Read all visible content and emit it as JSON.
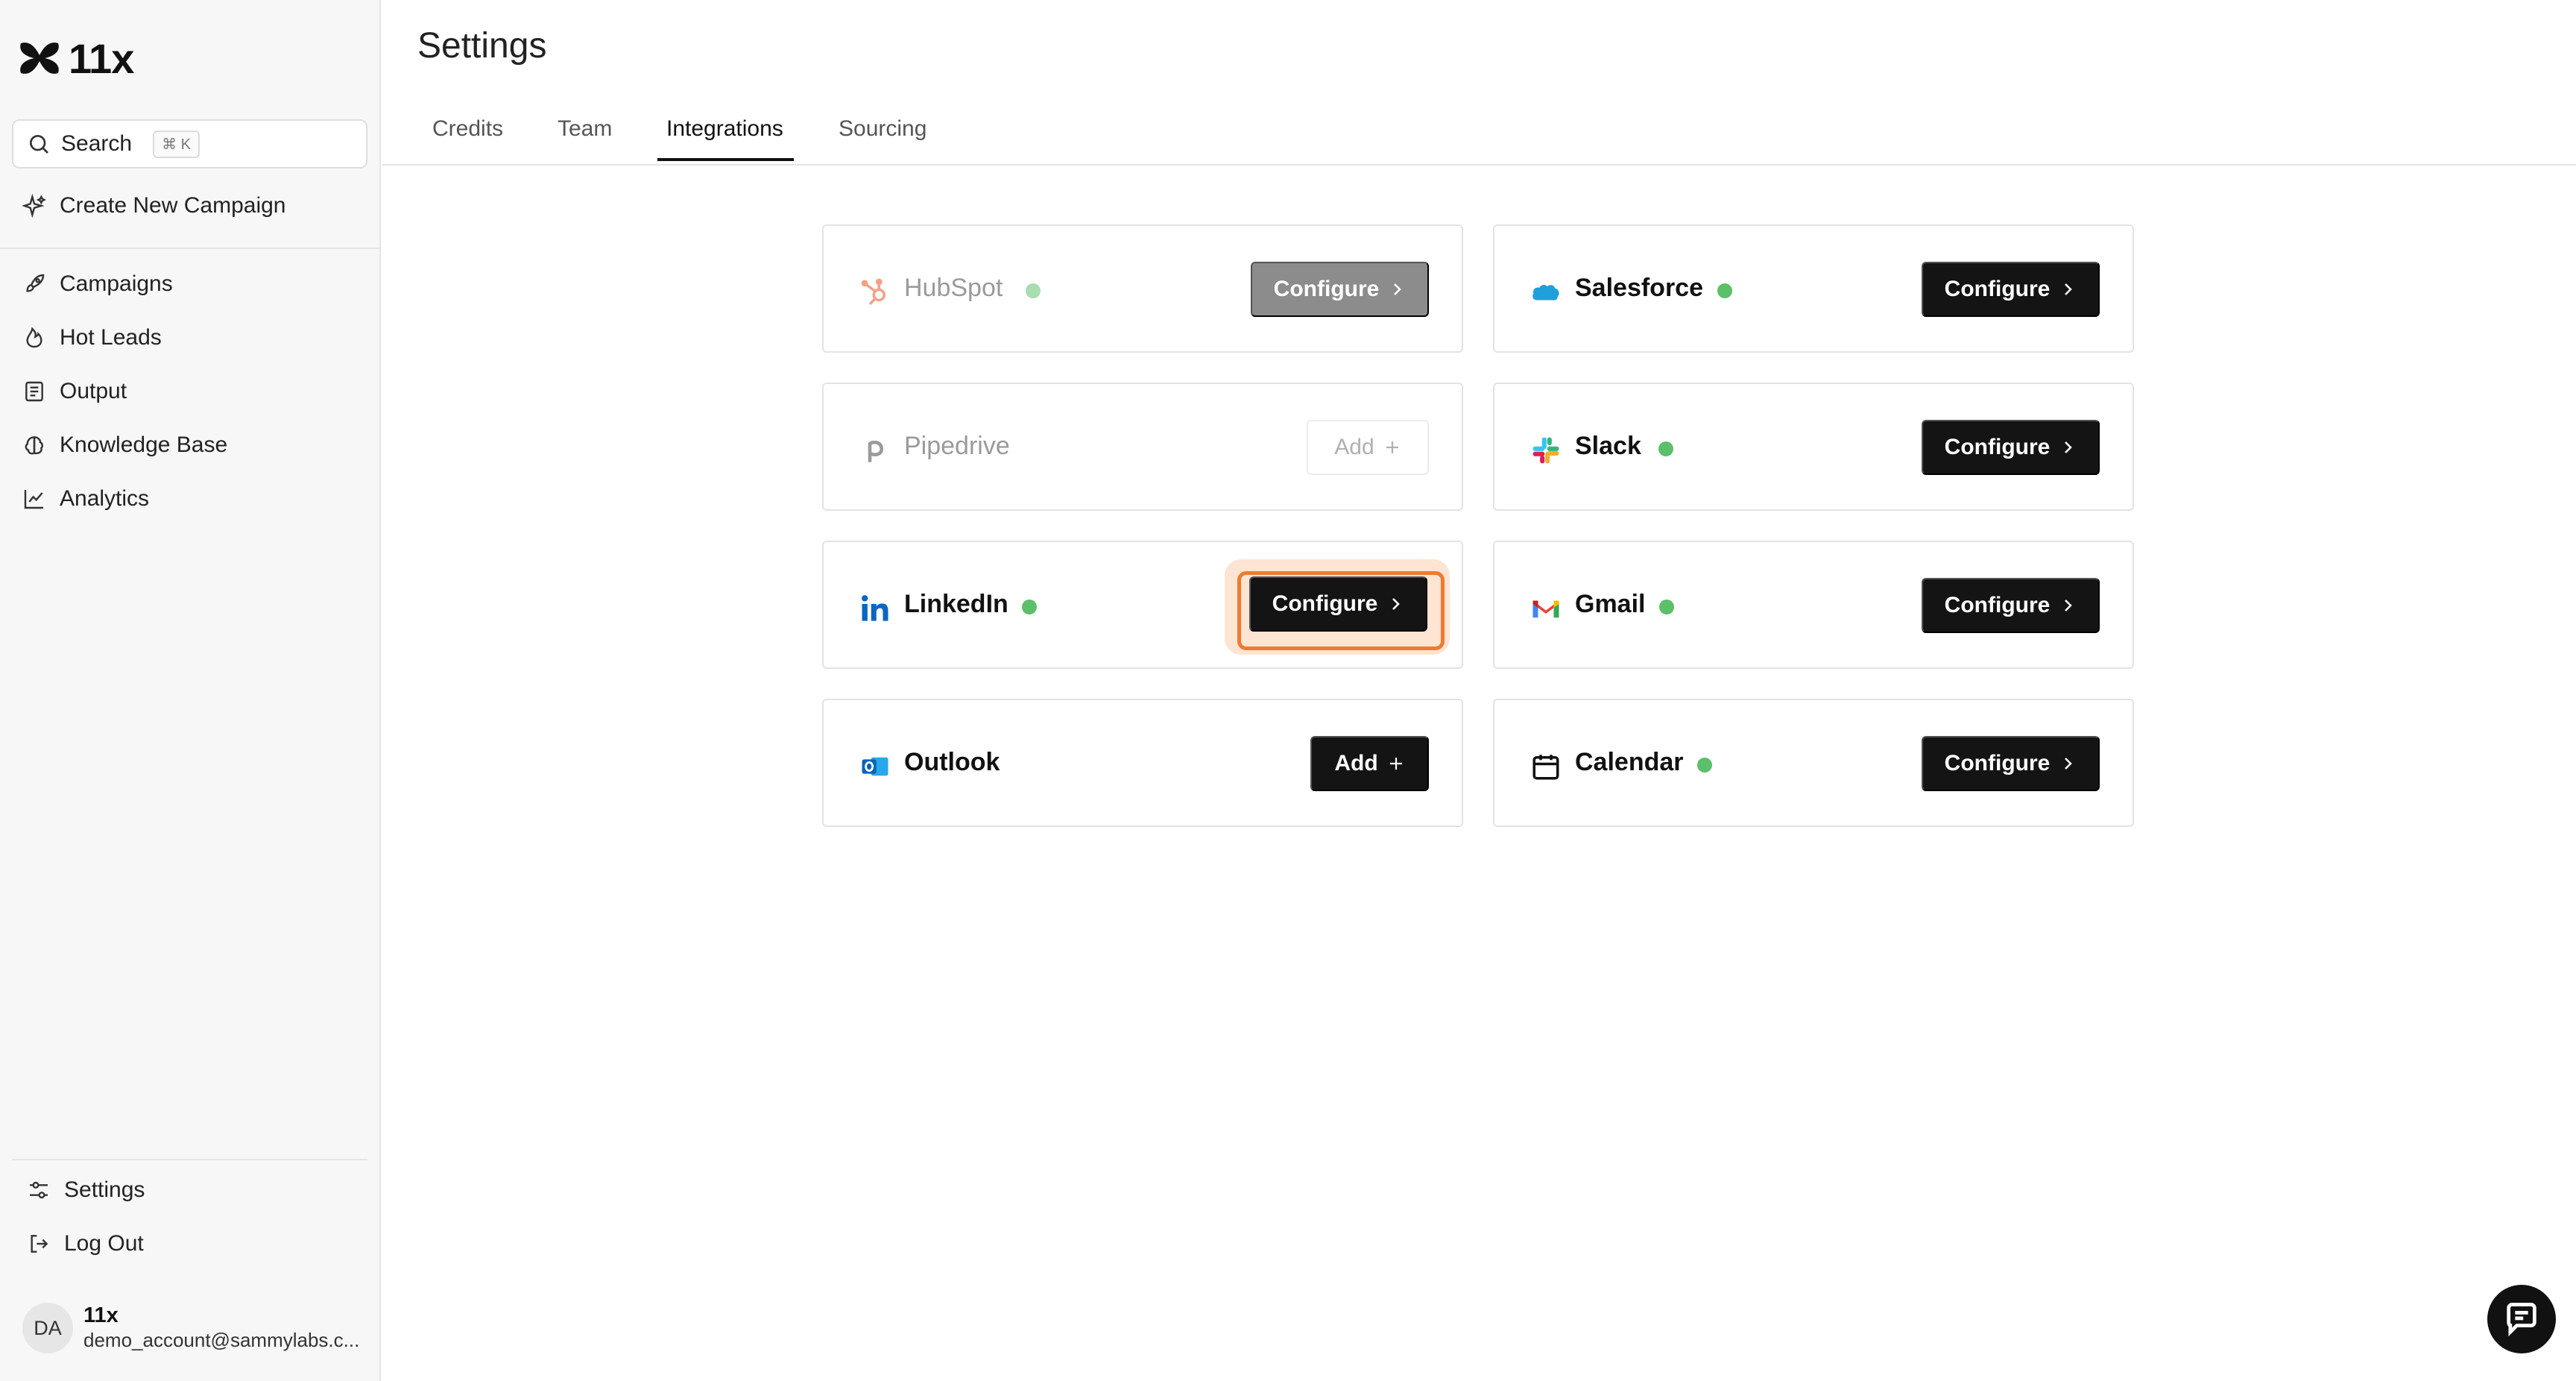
{
  "app": {
    "logo_text": "11x"
  },
  "sidebar": {
    "search_label": "Search",
    "search_shortcut": "⌘ K",
    "create_label": "Create New Campaign",
    "nav": [
      {
        "label": "Campaigns",
        "icon": "rocket-icon"
      },
      {
        "label": "Hot Leads",
        "icon": "flame-icon"
      },
      {
        "label": "Output",
        "icon": "list-icon"
      },
      {
        "label": "Knowledge Base",
        "icon": "brain-icon"
      },
      {
        "label": "Analytics",
        "icon": "chart-line-icon"
      }
    ],
    "settings_label": "Settings",
    "logout_label": "Log Out",
    "account": {
      "initials": "DA",
      "name": "11x",
      "email": "demo_account@sammylabs.c..."
    }
  },
  "page": {
    "title": "Settings",
    "tabs": [
      "Credits",
      "Team",
      "Integrations",
      "Sourcing"
    ],
    "active_tab": "Integrations"
  },
  "integrations": [
    {
      "name": "HubSpot",
      "connected": true,
      "action": "Configure",
      "state": "disabled"
    },
    {
      "name": "Salesforce",
      "connected": true,
      "action": "Configure",
      "state": "enabled"
    },
    {
      "name": "Pipedrive",
      "connected": false,
      "action": "Add",
      "state": "disabled"
    },
    {
      "name": "Slack",
      "connected": true,
      "action": "Configure",
      "state": "enabled"
    },
    {
      "name": "LinkedIn",
      "connected": true,
      "action": "Configure",
      "state": "highlighted"
    },
    {
      "name": "Gmail",
      "connected": true,
      "action": "Configure",
      "state": "enabled"
    },
    {
      "name": "Outlook",
      "connected": false,
      "action": "Add",
      "state": "enabled"
    },
    {
      "name": "Calendar",
      "connected": true,
      "action": "Configure",
      "state": "enabled"
    }
  ],
  "colors": {
    "connected_dot": "#5cbf6a",
    "primary_button": "#141414",
    "highlight": "#ef7b2f"
  }
}
